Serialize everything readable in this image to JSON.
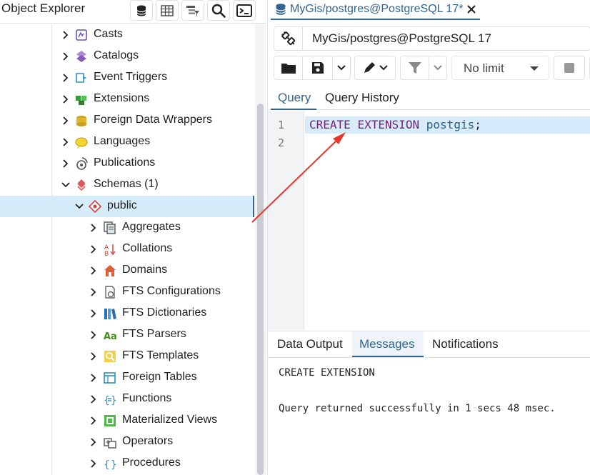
{
  "object_explorer": {
    "title": "Object Explorer",
    "toolbar_icons": [
      "database-icon",
      "table-grid-icon",
      "table-tree-icon",
      "search-icon",
      "terminal-icon"
    ]
  },
  "tree": {
    "items": [
      {
        "label": "Casts",
        "icon": "casts-icon",
        "level": 1
      },
      {
        "label": "Catalogs",
        "icon": "catalogs-icon",
        "level": 1
      },
      {
        "label": "Event Triggers",
        "icon": "event-triggers-icon",
        "level": 1
      },
      {
        "label": "Extensions",
        "icon": "extensions-icon",
        "level": 1
      },
      {
        "label": "Foreign Data Wrappers",
        "icon": "foreign-data-wrappers-icon",
        "level": 1
      },
      {
        "label": "Languages",
        "icon": "languages-icon",
        "level": 1
      },
      {
        "label": "Publications",
        "icon": "publications-icon",
        "level": 1
      },
      {
        "label": "Schemas (1)",
        "icon": "schemas-icon",
        "level": 1,
        "expanded": true
      },
      {
        "label": "public",
        "icon": "schema-public-icon",
        "level": 2,
        "expanded": true,
        "selected": true
      },
      {
        "label": "Aggregates",
        "icon": "aggregates-icon",
        "level": 3
      },
      {
        "label": "Collations",
        "icon": "collations-icon",
        "level": 3
      },
      {
        "label": "Domains",
        "icon": "domains-icon",
        "level": 3
      },
      {
        "label": "FTS Configurations",
        "icon": "fts-configurations-icon",
        "level": 3
      },
      {
        "label": "FTS Dictionaries",
        "icon": "fts-dictionaries-icon",
        "level": 3
      },
      {
        "label": "FTS Parsers",
        "icon": "fts-parsers-icon",
        "level": 3
      },
      {
        "label": "FTS Templates",
        "icon": "fts-templates-icon",
        "level": 3
      },
      {
        "label": "Foreign Tables",
        "icon": "foreign-tables-icon",
        "level": 3
      },
      {
        "label": "Functions",
        "icon": "functions-icon",
        "level": 3
      },
      {
        "label": "Materialized Views",
        "icon": "materialized-views-icon",
        "level": 3
      },
      {
        "label": "Operators",
        "icon": "operators-icon",
        "level": 3
      },
      {
        "label": "Procedures",
        "icon": "procedures-icon",
        "level": 3
      }
    ]
  },
  "query_tool": {
    "tab_title": "MyGis/postgres@PostgreSQL 17*",
    "connection": "MyGis/postgres@PostgreSQL 17",
    "limit_select": "No limit",
    "editor_tabs": [
      "Query",
      "Query History"
    ],
    "active_editor_tab": "Query",
    "line_numbers": [
      "1",
      "2"
    ],
    "code": {
      "kw1": "CREATE",
      "kw2": "EXTENSION",
      "ident": "postgis",
      "punct": ";"
    },
    "output_tabs": [
      "Data Output",
      "Messages",
      "Notifications"
    ],
    "active_output_tab": "Messages",
    "messages": [
      "CREATE EXTENSION",
      "Query returned successfully in 1 secs 48 msec."
    ]
  },
  "colors": {
    "accent": "#326690",
    "selection": "#d6ecfa",
    "sql_keyword": "#7a1c7a",
    "annotation_arrow": "#e8362d"
  }
}
